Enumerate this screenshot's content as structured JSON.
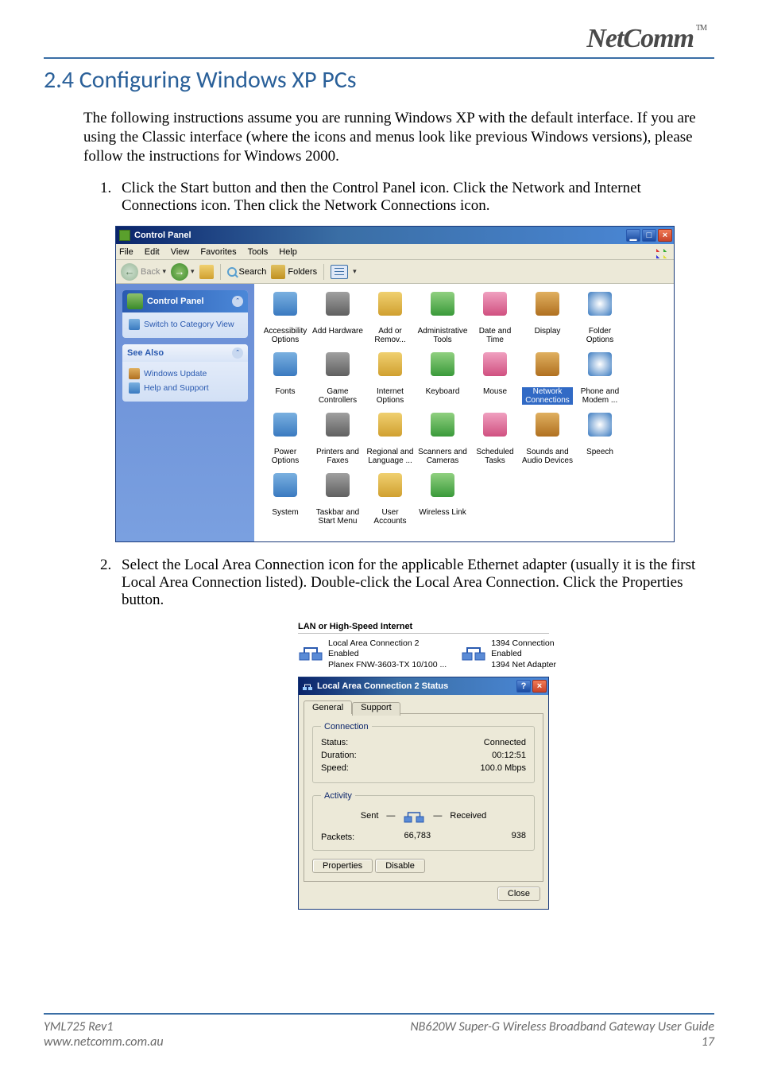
{
  "brand": {
    "name": "NetComm",
    "tm": "TM"
  },
  "section": {
    "title": "2.4 Configuring Windows XP PCs"
  },
  "intro": "The following instructions assume you are running Windows XP with the default interface. If you are using the Classic interface (where the icons and menus look like previous Windows versions), please follow the instructions for Windows 2000.",
  "steps": [
    "Click the Start button and then the Control Panel icon. Click the Network and Internet Connections icon. Then click the Network Connections icon.",
    "Select the Local Area Connection icon for the applicable Ethernet adapter (usually it is the first Local Area Connection listed). Double-click the Local Area Connection. Click the Properties button."
  ],
  "ss1": {
    "title": "Control Panel",
    "menubar": [
      "File",
      "Edit",
      "View",
      "Favorites",
      "Tools",
      "Help"
    ],
    "toolbar": {
      "back": "Back",
      "search": "Search",
      "folders": "Folders"
    },
    "side": {
      "panel1": {
        "title": "Control Panel",
        "link1": "Switch to Category View"
      },
      "panel2": {
        "title": "See Also",
        "link1": "Windows Update",
        "link2": "Help and Support"
      }
    },
    "items": [
      "Accessibility Options",
      "Add Hardware",
      "Add or Remov...",
      "Administrative Tools",
      "Date and Time",
      "Display",
      "Folder Options",
      "Fonts",
      "Game Controllers",
      "Internet Options",
      "Keyboard",
      "Mouse",
      "Network Connections",
      "Phone and Modem ...",
      "Power Options",
      "Printers and Faxes",
      "Regional and Language ...",
      "Scanners and Cameras",
      "Scheduled Tasks",
      "Sounds and Audio Devices",
      "Speech",
      "System",
      "Taskbar and Start Menu",
      "User Accounts",
      "Wireless Link"
    ],
    "highlight_index": 12
  },
  "ss2": {
    "lan_header": "LAN or High-Speed Internet",
    "conn1": {
      "name": "Local Area Connection 2",
      "status": "Enabled",
      "device": "Planex FNW-3603-TX 10/100 ..."
    },
    "conn2": {
      "name": "1394 Connection",
      "status": "Enabled",
      "device": "1394 Net Adapter"
    },
    "dialog": {
      "title": "Local Area Connection 2 Status",
      "tabs": {
        "general": "General",
        "support": "Support"
      },
      "group1": {
        "legend": "Connection",
        "status_label": "Status:",
        "status_value": "Connected",
        "duration_label": "Duration:",
        "duration_value": "00:12:51",
        "speed_label": "Speed:",
        "speed_value": "100.0 Mbps"
      },
      "group2": {
        "legend": "Activity",
        "sent": "Sent",
        "received": "Received",
        "packets_label": "Packets:",
        "packets_sent": "66,783",
        "packets_received": "938"
      },
      "buttons": {
        "properties": "Properties",
        "disable": "Disable",
        "close": "Close"
      }
    }
  },
  "footer": {
    "left1": "YML725 Rev1",
    "left2": "www.netcomm.com.au",
    "right1": "NB620W Super-G Wireless Broadband  Gateway User Guide",
    "right2": "17"
  }
}
